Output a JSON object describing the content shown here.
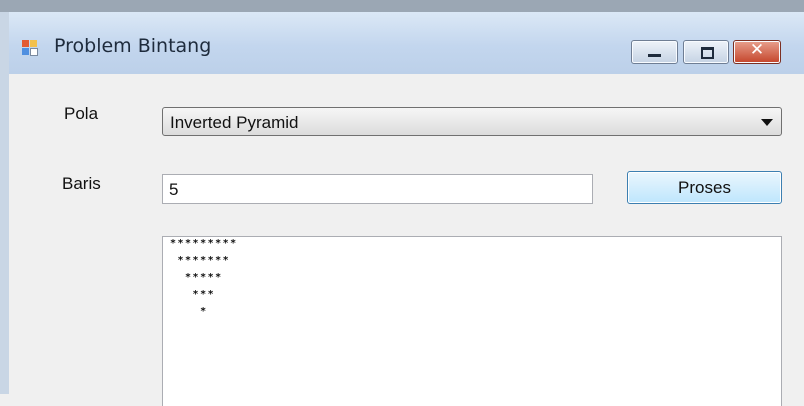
{
  "window": {
    "title": "Problem Bintang",
    "close_glyph": "✕",
    "icons": [
      "app-icon",
      "minimize-icon",
      "maximize-icon",
      "close-icon"
    ]
  },
  "form": {
    "pola_label": "Pola",
    "pola_selected": "Inverted Pyramid",
    "baris_label": "Baris",
    "baris_value": "5",
    "proses_label": "Proses"
  },
  "output": {
    "lines": [
      "*********",
      " *******",
      "  *****",
      "   ***",
      "    *"
    ]
  }
}
